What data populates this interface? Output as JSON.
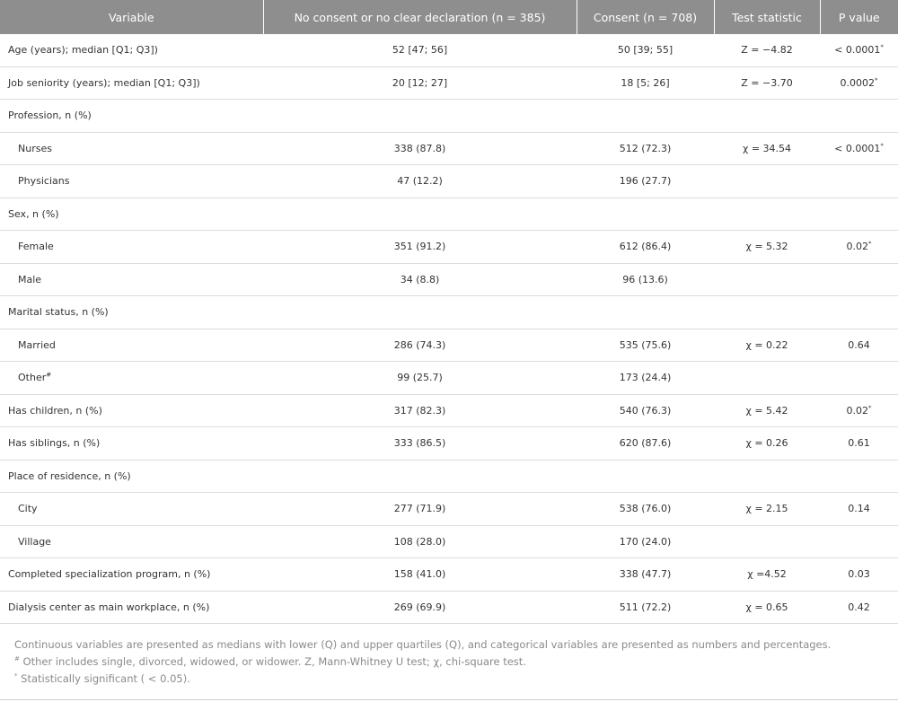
{
  "headers": [
    "Variable",
    "No consent or no clear declaration (n = 385)",
    "Consent (n = 708)",
    "Test statistic",
    "P value"
  ],
  "rows": [
    {
      "label": "Age (years); median [Q1; Q3])",
      "sub": false,
      "nc": "52 [47; 56]",
      "c": "50 [39; 55]",
      "stat": "Z = −4.82",
      "p": "< 0.0001",
      "psup": "*"
    },
    {
      "label": "Job seniority (years); median [Q1; Q3])",
      "sub": false,
      "nc": "20 [12; 27]",
      "c": "18 [5; 26]",
      "stat": "Z = −3.70",
      "p": "0.0002",
      "psup": "*"
    },
    {
      "label": "Profession, n (%)",
      "sub": false,
      "nc": "",
      "c": "",
      "stat": "",
      "p": "",
      "psup": ""
    },
    {
      "label": "Nurses",
      "sub": true,
      "nc": "338 (87.8)",
      "c": "512 (72.3)",
      "stat": "χ = 34.54",
      "p": "< 0.0001",
      "psup": "*"
    },
    {
      "label": "Physicians",
      "sub": true,
      "nc": "47 (12.2)",
      "c": "196 (27.7)",
      "stat": "",
      "p": "",
      "psup": ""
    },
    {
      "label": "Sex, n (%)",
      "sub": false,
      "nc": "",
      "c": "",
      "stat": "",
      "p": "",
      "psup": ""
    },
    {
      "label": "Female",
      "sub": true,
      "nc": "351 (91.2)",
      "c": "612 (86.4)",
      "stat": "χ = 5.32",
      "p": "0.02",
      "psup": "*"
    },
    {
      "label": "Male",
      "sub": true,
      "nc": "34 (8.8)",
      "c": "96 (13.6)",
      "stat": "",
      "p": "",
      "psup": ""
    },
    {
      "label": "Marital status, n (%)",
      "sub": false,
      "nc": "",
      "c": "",
      "stat": "",
      "p": "",
      "psup": ""
    },
    {
      "label": "Married",
      "sub": true,
      "nc": "286 (74.3)",
      "c": "535 (75.6)",
      "stat": "χ = 0.22",
      "p": "0.64",
      "psup": ""
    },
    {
      "label": "Other",
      "labelsup": "#",
      "sub": true,
      "nc": "99 (25.7)",
      "c": "173 (24.4)",
      "stat": "",
      "p": "",
      "psup": ""
    },
    {
      "label": "Has children, n (%)",
      "sub": false,
      "nc": "317 (82.3)",
      "c": "540 (76.3)",
      "stat": "χ = 5.42",
      "p": "0.02",
      "psup": "*"
    },
    {
      "label": "Has siblings, n (%)",
      "sub": false,
      "nc": "333 (86.5)",
      "c": "620 (87.6)",
      "stat": "χ = 0.26",
      "p": "0.61",
      "psup": ""
    },
    {
      "label": "Place of residence, n (%)",
      "sub": false,
      "nc": "",
      "c": "",
      "stat": "",
      "p": "",
      "psup": ""
    },
    {
      "label": "City",
      "sub": true,
      "nc": "277 (71.9)",
      "c": "538 (76.0)",
      "stat": "χ = 2.15",
      "p": "0.14",
      "psup": ""
    },
    {
      "label": "Village",
      "sub": true,
      "nc": "108 (28.0)",
      "c": "170 (24.0)",
      "stat": "",
      "p": "",
      "psup": ""
    },
    {
      "label": "Completed specialization program, n (%)",
      "sub": false,
      "nc": "158 (41.0)",
      "c": "338 (47.7)",
      "stat": "χ =4.52",
      "p": "0.03",
      "psup": ""
    },
    {
      "label": "Dialysis center as main workplace, n (%)",
      "sub": false,
      "nc": "269 (69.9)",
      "c": "511 (72.2)",
      "stat": "χ = 0.65",
      "p": "0.42",
      "psup": ""
    }
  ],
  "footnotes": {
    "line1": "Continuous variables are presented as medians with lower (Q) and upper quartiles (Q), and categorical variables are presented as numbers and percentages.",
    "line2_mark": "#",
    "line2": " Other includes single, divorced, widowed, or widower. Z, Mann-Whitney U test; χ, chi-square test.",
    "line3_mark": "*",
    "line3": " Statistically significant ( < 0.05)."
  },
  "colors": {
    "header_bg": "#8e8e8e",
    "border": "#dcdcdc",
    "footnote_text": "#8a8a8a"
  }
}
